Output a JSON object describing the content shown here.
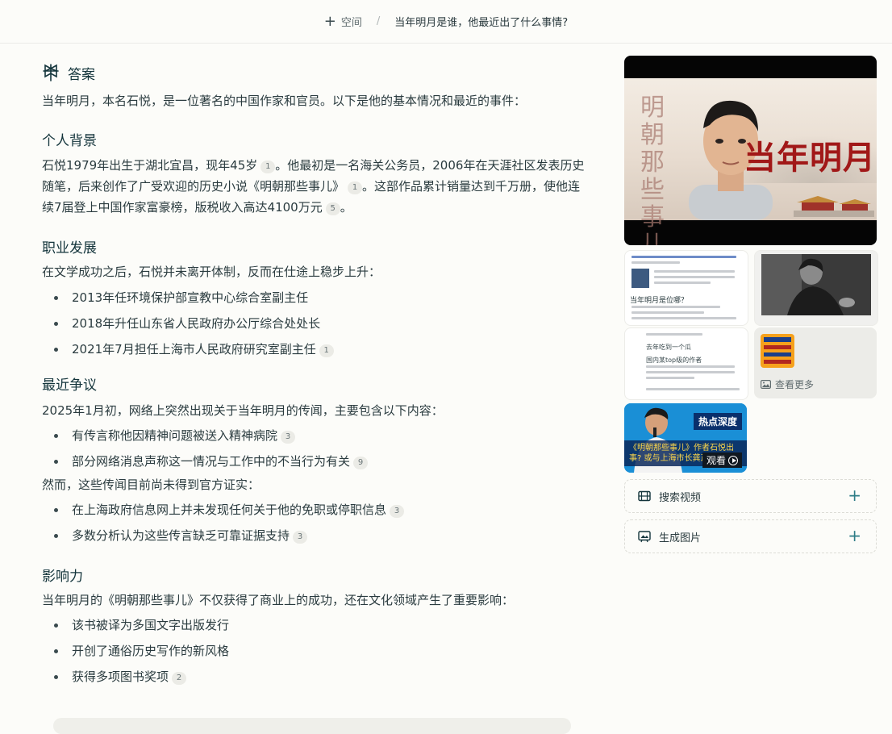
{
  "topbar": {
    "space_label": "空间",
    "thread_title": "当年明月是谁，他最近出了什么事情?"
  },
  "answer": {
    "header_label": "答案",
    "intro": "当年明月，本名石悦，是一位著名的中国作家和官员。以下是他的基本情况和最近的事件：",
    "sections": [
      {
        "heading": "个人背景",
        "para": {
          "a": "石悦1979年出生于湖北宜昌，现年45岁",
          "c1": "1",
          "b": "。他最初是一名海关公务员，2006年在天涯社区发表历史随笔，后来创作了广受欢迎的历史小说《明朝那些事儿》",
          "c2": "1",
          "c": "。这部作品累计销量达到千万册，使他连续7届登上中国作家富豪榜，版税收入高达4100万元",
          "c3": "5",
          "d": "。"
        }
      },
      {
        "heading": "职业发展",
        "para": "在文学成功之后，石悦并未离开体制，反而在仕途上稳步上升：",
        "items": [
          {
            "text": "2013年任环境保护部宣教中心综合室副主任",
            "cite": ""
          },
          {
            "text": "2018年升任山东省人民政府办公厅综合处处长",
            "cite": ""
          },
          {
            "text": "2021年7月担任上海市人民政府研究室副主任",
            "cite": "1"
          }
        ]
      },
      {
        "heading": "最近争议",
        "para": "2025年1月初，网络上突然出现关于当年明月的传闻，主要包含以下内容：",
        "items": [
          {
            "text": "有传言称他因精神问题被送入精神病院",
            "cite": "3"
          },
          {
            "text": "部分网络消息声称这一情况与工作中的不当行为有关",
            "cite": "9"
          }
        ],
        "para2": "然而，这些传闻目前尚未得到官方证实：",
        "items2": [
          {
            "text": "在上海政府信息网上并未发现任何关于他的免职或停职信息",
            "cite": "3"
          },
          {
            "text": "多数分析认为这些传言缺乏可靠证据支持",
            "cite": "3"
          }
        ]
      },
      {
        "heading": "影响力",
        "para": "当年明月的《明朝那些事儿》不仅获得了商业上的成功，还在文化领域产生了重要影响：",
        "items": [
          {
            "text": "该书被译为多国文字出版发行",
            "cite": ""
          },
          {
            "text": "开创了通俗历史写作的新风格",
            "cite": ""
          },
          {
            "text": "获得多项图书奖项",
            "cite": "2"
          }
        ]
      }
    ]
  },
  "sidebar": {
    "hero_image": {
      "vertical_text": "明朝那些事儿",
      "title_text": "当年明月"
    },
    "thumbnails": {
      "t1_headline": "当年明月是位哪？",
      "t3_lines": [
        "去年吃到一个瓜",
        "国内某top级的作者"
      ],
      "t4_more_label": "查看更多",
      "t5_badge": "热点深度",
      "t5_caption": "《明朝那些事儿》作者石悦出事? 或与上海市长龚正往",
      "t5_watch": "观看"
    },
    "actions": [
      {
        "label": "搜索视频",
        "icon": "film-icon"
      },
      {
        "label": "生成图片",
        "icon": "image-generate-icon"
      }
    ]
  },
  "colors": {
    "accent": "#2e7d87",
    "text": "#13343b",
    "background": "#fcfcf9"
  }
}
